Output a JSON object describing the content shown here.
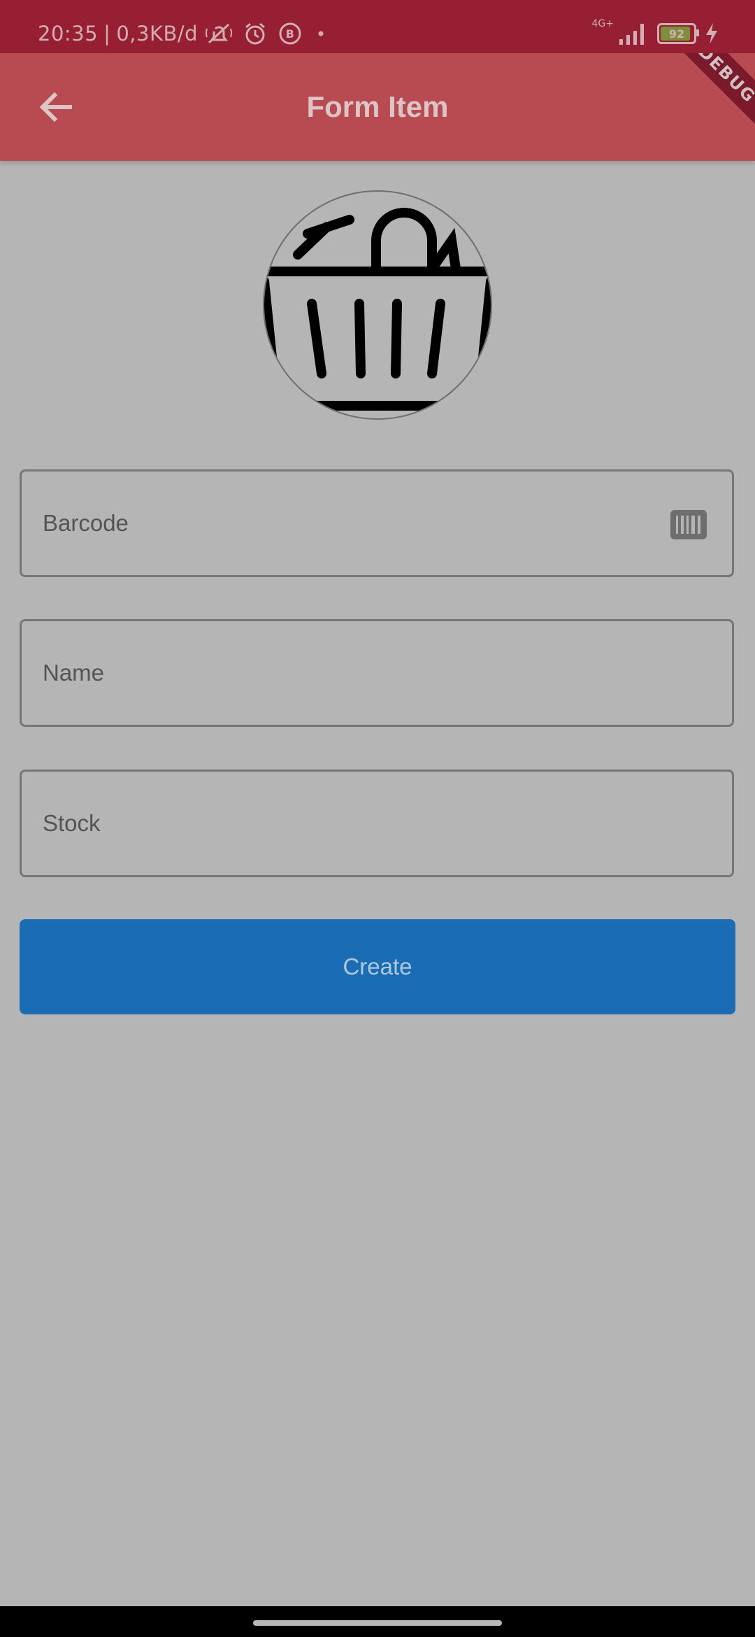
{
  "status_bar": {
    "time": "20:35",
    "separator": "|",
    "data_rate": "0,3KB/d",
    "network": "4G+",
    "battery_level": "92"
  },
  "app_bar": {
    "title": "Form Item",
    "back_icon": "arrow-left-icon",
    "debug_banner": "DEBUG"
  },
  "avatar": {
    "icon": "basket-icon"
  },
  "form": {
    "barcode": {
      "label": "Barcode",
      "icon": "barcode-icon"
    },
    "name": {
      "label": "Name"
    },
    "stock": {
      "label": "Stock"
    }
  },
  "actions": {
    "create_label": "Create"
  },
  "colors": {
    "status_bar": "#961f33",
    "app_bar": "#b84a52",
    "background": "#b5b5b5",
    "button": "#1a6cb5"
  }
}
